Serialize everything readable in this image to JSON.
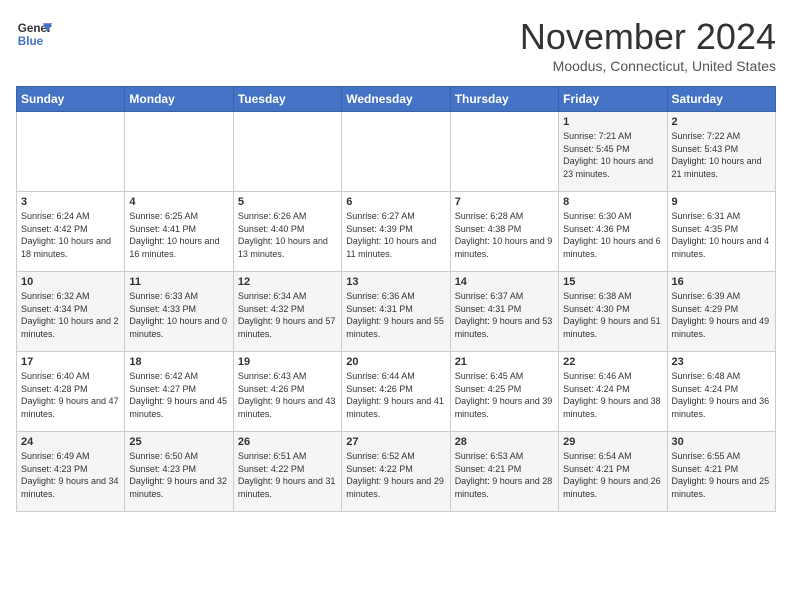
{
  "header": {
    "logo_line1": "General",
    "logo_line2": "Blue",
    "month": "November 2024",
    "location": "Moodus, Connecticut, United States"
  },
  "days_of_week": [
    "Sunday",
    "Monday",
    "Tuesday",
    "Wednesday",
    "Thursday",
    "Friday",
    "Saturday"
  ],
  "weeks": [
    [
      {
        "day": "",
        "info": ""
      },
      {
        "day": "",
        "info": ""
      },
      {
        "day": "",
        "info": ""
      },
      {
        "day": "",
        "info": ""
      },
      {
        "day": "",
        "info": ""
      },
      {
        "day": "1",
        "info": "Sunrise: 7:21 AM\nSunset: 5:45 PM\nDaylight: 10 hours and 23 minutes."
      },
      {
        "day": "2",
        "info": "Sunrise: 7:22 AM\nSunset: 5:43 PM\nDaylight: 10 hours and 21 minutes."
      }
    ],
    [
      {
        "day": "3",
        "info": "Sunrise: 6:24 AM\nSunset: 4:42 PM\nDaylight: 10 hours and 18 minutes."
      },
      {
        "day": "4",
        "info": "Sunrise: 6:25 AM\nSunset: 4:41 PM\nDaylight: 10 hours and 16 minutes."
      },
      {
        "day": "5",
        "info": "Sunrise: 6:26 AM\nSunset: 4:40 PM\nDaylight: 10 hours and 13 minutes."
      },
      {
        "day": "6",
        "info": "Sunrise: 6:27 AM\nSunset: 4:39 PM\nDaylight: 10 hours and 11 minutes."
      },
      {
        "day": "7",
        "info": "Sunrise: 6:28 AM\nSunset: 4:38 PM\nDaylight: 10 hours and 9 minutes."
      },
      {
        "day": "8",
        "info": "Sunrise: 6:30 AM\nSunset: 4:36 PM\nDaylight: 10 hours and 6 minutes."
      },
      {
        "day": "9",
        "info": "Sunrise: 6:31 AM\nSunset: 4:35 PM\nDaylight: 10 hours and 4 minutes."
      }
    ],
    [
      {
        "day": "10",
        "info": "Sunrise: 6:32 AM\nSunset: 4:34 PM\nDaylight: 10 hours and 2 minutes."
      },
      {
        "day": "11",
        "info": "Sunrise: 6:33 AM\nSunset: 4:33 PM\nDaylight: 10 hours and 0 minutes."
      },
      {
        "day": "12",
        "info": "Sunrise: 6:34 AM\nSunset: 4:32 PM\nDaylight: 9 hours and 57 minutes."
      },
      {
        "day": "13",
        "info": "Sunrise: 6:36 AM\nSunset: 4:31 PM\nDaylight: 9 hours and 55 minutes."
      },
      {
        "day": "14",
        "info": "Sunrise: 6:37 AM\nSunset: 4:31 PM\nDaylight: 9 hours and 53 minutes."
      },
      {
        "day": "15",
        "info": "Sunrise: 6:38 AM\nSunset: 4:30 PM\nDaylight: 9 hours and 51 minutes."
      },
      {
        "day": "16",
        "info": "Sunrise: 6:39 AM\nSunset: 4:29 PM\nDaylight: 9 hours and 49 minutes."
      }
    ],
    [
      {
        "day": "17",
        "info": "Sunrise: 6:40 AM\nSunset: 4:28 PM\nDaylight: 9 hours and 47 minutes."
      },
      {
        "day": "18",
        "info": "Sunrise: 6:42 AM\nSunset: 4:27 PM\nDaylight: 9 hours and 45 minutes."
      },
      {
        "day": "19",
        "info": "Sunrise: 6:43 AM\nSunset: 4:26 PM\nDaylight: 9 hours and 43 minutes."
      },
      {
        "day": "20",
        "info": "Sunrise: 6:44 AM\nSunset: 4:26 PM\nDaylight: 9 hours and 41 minutes."
      },
      {
        "day": "21",
        "info": "Sunrise: 6:45 AM\nSunset: 4:25 PM\nDaylight: 9 hours and 39 minutes."
      },
      {
        "day": "22",
        "info": "Sunrise: 6:46 AM\nSunset: 4:24 PM\nDaylight: 9 hours and 38 minutes."
      },
      {
        "day": "23",
        "info": "Sunrise: 6:48 AM\nSunset: 4:24 PM\nDaylight: 9 hours and 36 minutes."
      }
    ],
    [
      {
        "day": "24",
        "info": "Sunrise: 6:49 AM\nSunset: 4:23 PM\nDaylight: 9 hours and 34 minutes."
      },
      {
        "day": "25",
        "info": "Sunrise: 6:50 AM\nSunset: 4:23 PM\nDaylight: 9 hours and 32 minutes."
      },
      {
        "day": "26",
        "info": "Sunrise: 6:51 AM\nSunset: 4:22 PM\nDaylight: 9 hours and 31 minutes."
      },
      {
        "day": "27",
        "info": "Sunrise: 6:52 AM\nSunset: 4:22 PM\nDaylight: 9 hours and 29 minutes."
      },
      {
        "day": "28",
        "info": "Sunrise: 6:53 AM\nSunset: 4:21 PM\nDaylight: 9 hours and 28 minutes."
      },
      {
        "day": "29",
        "info": "Sunrise: 6:54 AM\nSunset: 4:21 PM\nDaylight: 9 hours and 26 minutes."
      },
      {
        "day": "30",
        "info": "Sunrise: 6:55 AM\nSunset: 4:21 PM\nDaylight: 9 hours and 25 minutes."
      }
    ]
  ]
}
